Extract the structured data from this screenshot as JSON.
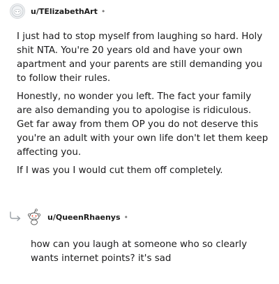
{
  "comment": {
    "username": "u/TElizabethArt",
    "separator": "•",
    "avatar_icon": "snoo-avatar-icon",
    "paragraphs": [
      "I just had to stop myself from laughing so hard. Holy shit NTA. You're 20 years old and have your own apartment and your parents are still demanding you to follow their rules.",
      "Honestly, no wonder you left. The fact your family are also demanding you to apologise is ridiculous. Get far away from them OP you do not deserve this you're an adult with your own life don't let them keep affecting you.",
      "If I was you I would cut them off completely."
    ]
  },
  "reply": {
    "username": "u/QueenRhaenys",
    "separator": "•",
    "avatar_icon": "snoo-avatar-icon",
    "reply_icon": "reply-arrow-icon",
    "text": "how can you laugh at someone who so clearly wants internet points? it's sad"
  }
}
